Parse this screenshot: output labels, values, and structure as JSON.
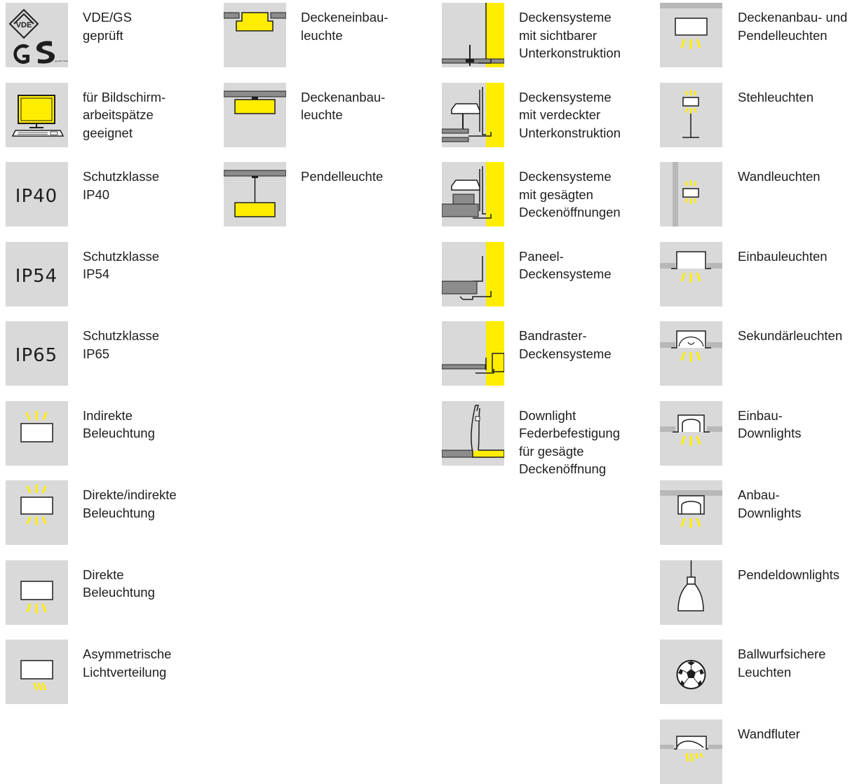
{
  "colors": {
    "tile": "#d9d9d9",
    "yellow": "#ffed00",
    "gray": "#8c8c8c",
    "outline": "#1e1e1e"
  },
  "columns": [
    {
      "items": [
        {
          "icon": "vde-gs-certification-icon",
          "label": "VDE/GS\ngeprüft",
          "logo": {
            "vde": "VDE",
            "gs": "GS",
            "gs_small": "geprüfte Sicherheit"
          }
        },
        {
          "icon": "screen-workplace-icon",
          "label": "für Bildschirm-\narbeitspätze\ngeeignet"
        },
        {
          "icon": "ip40-icon",
          "label": "Schutzklasse\nIP40",
          "code": "IP40"
        },
        {
          "icon": "ip54-icon",
          "label": "Schutzklasse\nIP54",
          "code": "IP54"
        },
        {
          "icon": "ip65-icon",
          "label": "Schutzklasse\nIP65",
          "code": "IP65"
        },
        {
          "icon": "indirect-lighting-icon",
          "label": "Indirekte\nBeleuchtung"
        },
        {
          "icon": "direct-indirect-lighting-icon",
          "label": "Direkte/indirekte\nBeleuchtung"
        },
        {
          "icon": "direct-lighting-icon",
          "label": "Direkte\nBeleuchtung"
        },
        {
          "icon": "asymmetric-light-icon",
          "label": "Asymmetrische\nLichtverteilung"
        }
      ]
    },
    {
      "items": [
        {
          "icon": "recessed-ceiling-luminaire-icon",
          "label": "Deckeneinbau-\nleuchte"
        },
        {
          "icon": "surface-ceiling-luminaire-icon",
          "label": "Deckenanbau-\nleuchte"
        },
        {
          "icon": "pendant-luminaire-icon",
          "label": "Pendelleuchte"
        }
      ]
    },
    {
      "items": [
        {
          "icon": "visible-grid-ceiling-icon",
          "label": "Deckensysteme\nmit sichtbarer\nUnterkonstruktion"
        },
        {
          "icon": "concealed-grid-ceiling-icon",
          "label": "Deckensysteme\nmit verdeckter\nUnterkonstruktion"
        },
        {
          "icon": "sawn-opening-ceiling-icon",
          "label": "Deckensysteme\nmit gesägten\nDeckenöffnungen"
        },
        {
          "icon": "panel-ceiling-icon",
          "label": "Paneel-\nDeckensysteme"
        },
        {
          "icon": "band-grid-ceiling-icon",
          "label": "Bandraster-\nDeckensysteme"
        },
        {
          "icon": "downlight-spring-mount-icon",
          "label": "Downlight\nFederbefestigung\nfür gesägte\nDeckenöffnung"
        }
      ]
    },
    {
      "items": [
        {
          "icon": "ceiling-pendant-luminaires-icon",
          "label": "Deckenanbau- und\nPendelleuchten"
        },
        {
          "icon": "floor-lamp-icon",
          "label": "Stehleuchten"
        },
        {
          "icon": "wall-luminaire-icon",
          "label": "Wandleuchten"
        },
        {
          "icon": "recessed-luminaire-icon",
          "label": "Einbauleuchten"
        },
        {
          "icon": "secondary-luminaire-icon",
          "label": "Sekundärleuchten"
        },
        {
          "icon": "recessed-downlight-icon",
          "label": "Einbau-\nDownlights"
        },
        {
          "icon": "surface-downlight-icon",
          "label": "Anbau-\nDownlights"
        },
        {
          "icon": "pendant-downlight-icon",
          "label": "Pendeldownlights"
        },
        {
          "icon": "ball-proof-icon",
          "label": "Ballwurfsichere\nLeuchten"
        },
        {
          "icon": "wall-washer-icon",
          "label": "Wandfluter"
        }
      ]
    }
  ]
}
